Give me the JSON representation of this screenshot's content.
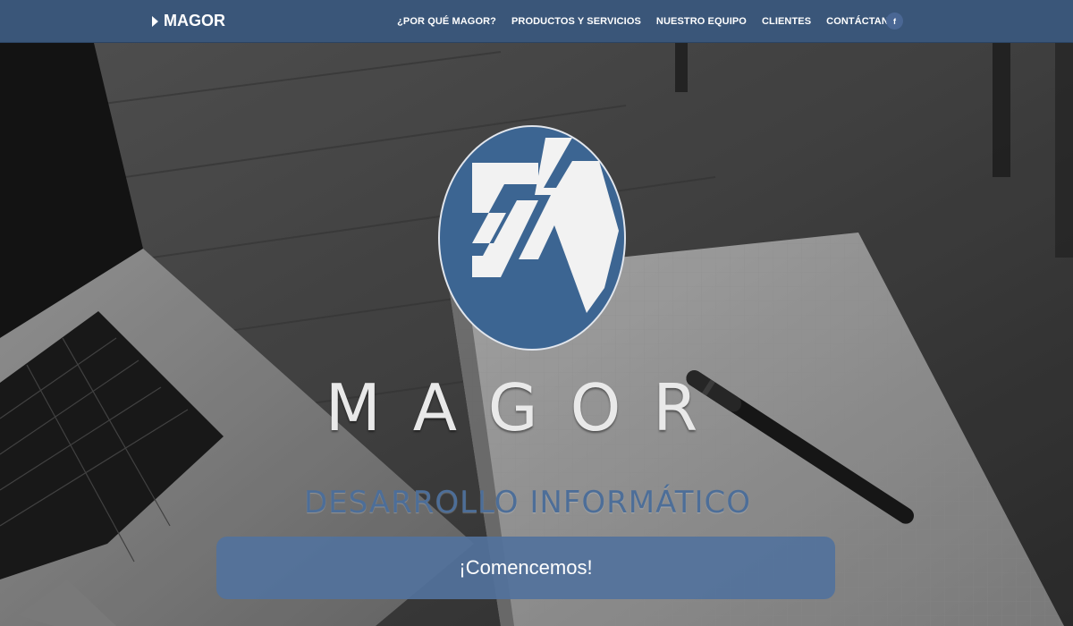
{
  "nav": {
    "brand": "MAGOR",
    "links": [
      "¿POR QUÉ MAGOR?",
      "PRODUCTOS Y SERVICIOS",
      "NUESTRO EQUIPO",
      "CLIENTES",
      "CONTÁCTANOS"
    ],
    "facebook_label": "f"
  },
  "hero": {
    "title": "MAGOR",
    "subtitle": "DESARROLLO INFORMÁTICO",
    "cta_label": "¡Comencemos!"
  },
  "colors": {
    "navbar": "#3a5679",
    "logo_blue": "#3c6592",
    "subtitle": "#4d6e98",
    "cta": "#53729c"
  },
  "icons": {
    "brand": "triangle-right-icon",
    "facebook": "facebook-icon",
    "logo": "magor-logo-icon"
  }
}
